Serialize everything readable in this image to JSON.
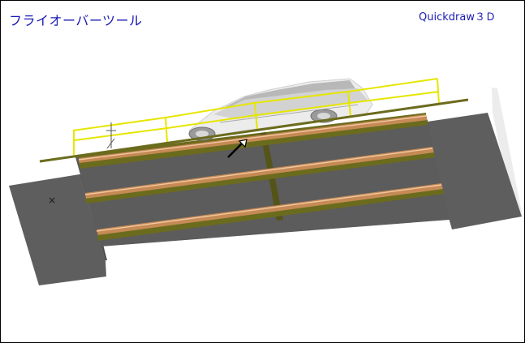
{
  "window": {
    "title": "フライオーバーツール",
    "engine_label": "Quickdraw３Ｄ"
  },
  "scene": {
    "objects": [
      "bridge-deck",
      "guard-rail",
      "car-model",
      "road-pipes",
      "ramp-left",
      "ramp-right"
    ],
    "cursor": "arrow-cursor",
    "marker": "×"
  },
  "colors": {
    "label": "#1a1ab4",
    "road": "#5c5c5c",
    "pipe": "#c58a55",
    "rail": "#e6e600",
    "deck": "#6b6b1e"
  }
}
